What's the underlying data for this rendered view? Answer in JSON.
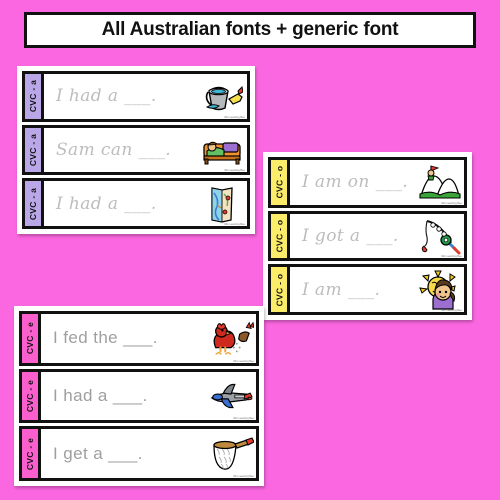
{
  "header": {
    "title": "All Australian fonts + generic font"
  },
  "background_color": "#fb67e0",
  "groups": [
    {
      "id": "group-a",
      "vowel_label": "CVC - a",
      "tab_color": "#b9a7e8",
      "font_style": "cursive",
      "cards": [
        {
          "sentence": "I had a ___.",
          "image": "bucket-icon",
          "credit": "Mrs Learning Bee"
        },
        {
          "sentence": "Sam can ___.",
          "image": "nap-bed-icon",
          "credit": "Mrs Learning Bee"
        },
        {
          "sentence": "I had a ___.",
          "image": "map-icon",
          "credit": "Mrs Learning Bee"
        }
      ]
    },
    {
      "id": "group-o",
      "vowel_label": "CVC - o",
      "tab_color": "#fbec6a",
      "font_style": "cursive",
      "cards": [
        {
          "sentence": "I am on ___.",
          "image": "mountain-top-icon",
          "credit": "Mrs Learning Bee"
        },
        {
          "sentence": "I got a ___.",
          "image": "fishing-rod-icon",
          "credit": "Mrs Learning Bee"
        },
        {
          "sentence": "I am ___.",
          "image": "hot-sun-girl-icon",
          "credit": "Mrs Learning Bee"
        }
      ]
    },
    {
      "id": "group-e",
      "vowel_label": "CVC - e",
      "tab_color": "#fb5fcd",
      "font_style": "print",
      "cards": [
        {
          "sentence": "I fed the ___.",
          "image": "red-hen-icon",
          "credit": "Mrs Learning Bee"
        },
        {
          "sentence": "I had a ___.",
          "image": "jet-plane-icon",
          "credit": "Mrs Learning Bee"
        },
        {
          "sentence": "I get a ___.",
          "image": "net-icon",
          "credit": "Mrs Learning Bee"
        }
      ]
    }
  ]
}
